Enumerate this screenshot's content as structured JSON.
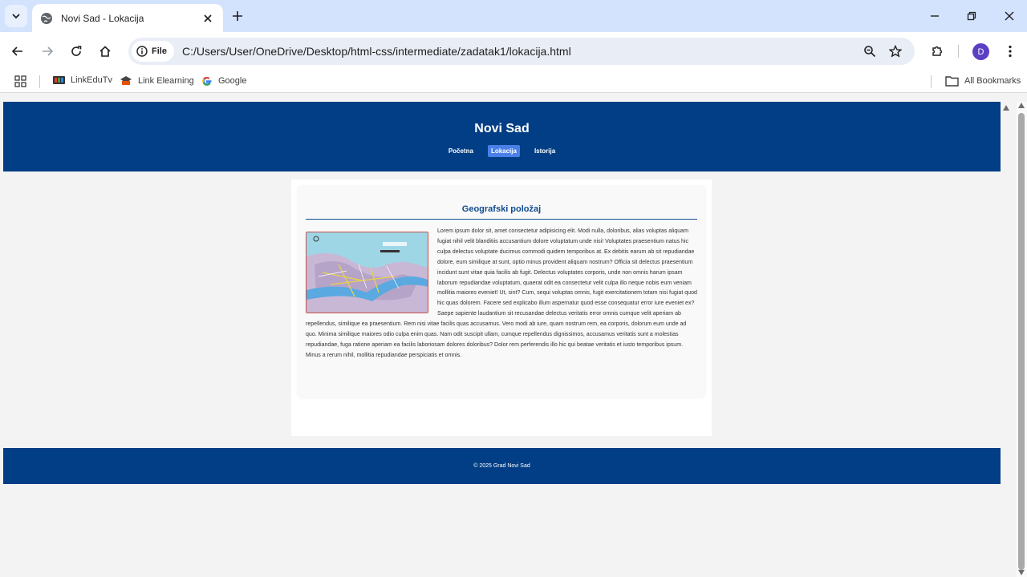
{
  "browser": {
    "tab_title": "Novi Sad - Lokacija",
    "site_chip_label": "File",
    "url": "C:/Users/User/OneDrive/Desktop/html-css/intermediate/zadatak1/lokacija.html",
    "profile_initial": "D",
    "bookmarks": [
      "LinkEduTv",
      "Link Elearning",
      "Google"
    ],
    "all_bookmarks_label": "All Bookmarks"
  },
  "page": {
    "site_title": "Novi Sad",
    "nav": [
      {
        "label": "Početna",
        "active": false
      },
      {
        "label": "Lokacija",
        "active": true
      },
      {
        "label": "Istorija",
        "active": false
      }
    ],
    "section_title": "Geografski položaj",
    "map_alt": "NOVI SAD",
    "article_text": "Lorem ipsum dolor sit, amet consectetur adipisicing elit. Modi nulla, doloribus, alias voluptas aliquam fugiat nihil velit blanditiis accusantium dolore voluptatum unde nisi! Voluptates praesentium natus hic culpa delectus voluptate ducimus commodi quidem temporibus at. Ex debitis earum ab sit repudiandae dolore, eum similique at sunt, optio minus provident aliquam nostrum? Officia sit delectus praesentium incidunt sunt vitae quia facilis ab fugit. Delectus voluptates corporis, unde non omnis harum ipsam laborum repudiandae voluptatum, quaerat odit ea consectetur velit culpa illo neque nobis eum veniam mollitia maiores eveniet! Ut, sint? Cum, sequi voluptas omnis, fugit exercitationem totam nisi fugiat quod hic quas dolorem. Facere sed explicabo illum aspernatur quod esse consequatur error iure eveniet ex? Saepe sapiente laudantium sit recusandae delectus veritatis error omnis cumque velit aperiam ab repellendus, similique ea praesentium. Rem nisi vitae facilis quas accusamus. Vero modi ab iure, quam nostrum rem, ea corporis, dolorum eum unde ad quo. Minima similique maiores odio culpa enim quas. Nam odit suscipit ullam, cumque repellendus dignissimos, accusamus veritatis sunt a molestias repudiandae, fuga ratione aperiam ea facilis laboriosam dolores doloribus? Dolor rem perferendis illo hic qui beatae veritatis et iusto temporibus ipsum. Minus a rerum nihil, mollitia repudiandae perspiciatis et omnis.",
    "footer_text": "© 2025 Grad Novi Sad"
  },
  "colors": {
    "header_bg": "#023e85",
    "nav_active_bg": "#4a7fe8",
    "section_title": "#0f4b8f",
    "tabbar_bg": "#d3e3fd",
    "omnibox_bg": "#e9eef6",
    "avatar_bg": "#5b3fc4"
  },
  "icons": {
    "tab_search": "chevron-down-icon",
    "favicon": "globe-icon",
    "tab_close": "close-icon",
    "new_tab": "plus-icon",
    "back": "arrow-left-icon",
    "forward": "arrow-right-icon",
    "reload": "reload-icon",
    "home": "home-icon",
    "site_info": "info-icon",
    "zoom": "zoom-icon",
    "bookmark_star": "star-icon",
    "extensions": "puzzle-icon",
    "menu": "kebab-menu-icon",
    "apps": "apps-grid-icon",
    "folder": "folder-icon"
  }
}
